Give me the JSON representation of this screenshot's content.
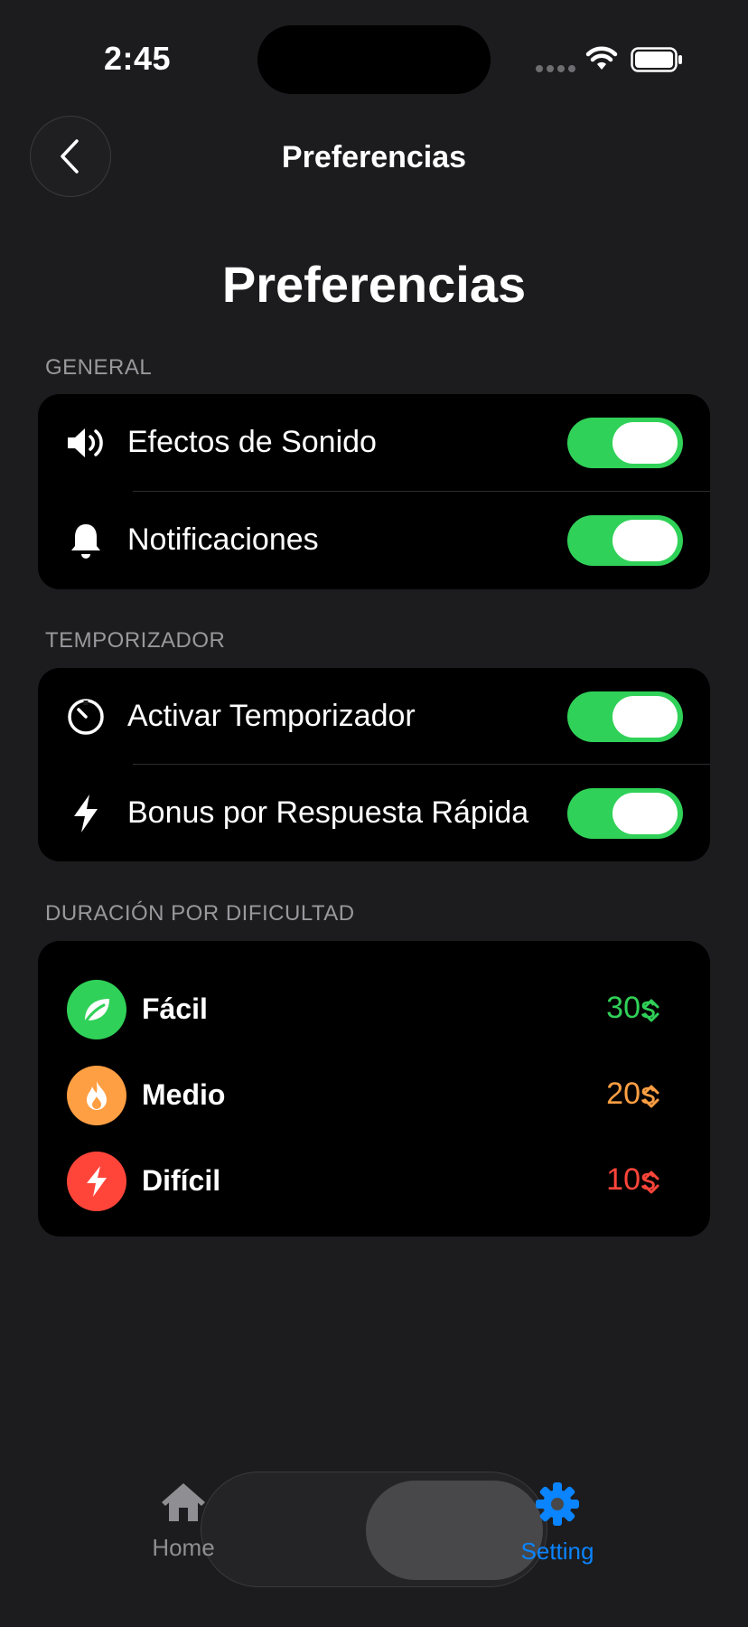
{
  "status_bar": {
    "time": "2:45"
  },
  "nav": {
    "title": "Preferencias"
  },
  "page": {
    "large_title": "Preferencias"
  },
  "sections": {
    "general": {
      "header": "GENERAL",
      "rows": [
        {
          "label": "Efectos de Sonido",
          "icon": "speaker-icon",
          "enabled": true
        },
        {
          "label": "Notificaciones",
          "icon": "bell-icon",
          "enabled": true
        }
      ]
    },
    "timer": {
      "header": "TEMPORIZADOR",
      "rows": [
        {
          "label": "Activar Temporizador",
          "icon": "timer-icon",
          "enabled": true
        },
        {
          "label": "Bonus por Respuesta Rápida",
          "icon": "bolt-icon",
          "enabled": true
        }
      ]
    },
    "difficulty": {
      "header": "DURACIÓN POR DIFICULTAD",
      "rows": [
        {
          "label": "Fácil",
          "value": "30s",
          "icon": "leaf-icon",
          "color": "#30d158"
        },
        {
          "label": "Medio",
          "value": "20s",
          "icon": "flame-icon",
          "color": "#ff9f43"
        },
        {
          "label": "Difícil",
          "value": "10s",
          "icon": "bolt-icon",
          "color": "#ff453a"
        }
      ]
    }
  },
  "tab_bar": {
    "home": {
      "label": "Home",
      "icon": "house-icon",
      "color": "#8e8e93"
    },
    "setting": {
      "label": "Setting",
      "icon": "gear-icon",
      "color": "#0a84ff",
      "selected": true
    }
  },
  "colors": {
    "accent": "#0a84ff",
    "toggle_on": "#30d158"
  }
}
